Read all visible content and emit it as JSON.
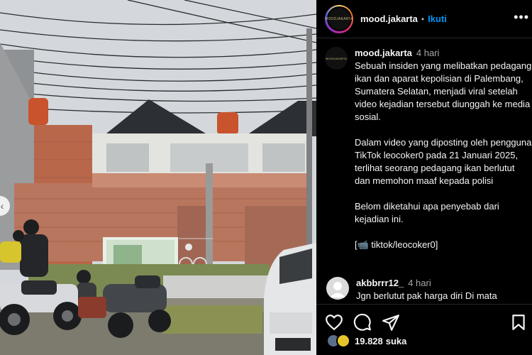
{
  "post": {
    "username": "mood.jakarta",
    "separator": "•",
    "follow_label": "Ikuti",
    "more_label": "•••",
    "avatar_text": "MOODJAKARTA"
  },
  "caption": {
    "username": "mood.jakarta",
    "time": "4 hari",
    "paragraphs": [
      "Sebuah insiden yang melibatkan pedagang ikan dan aparat kepolisian di Palembang, Sumatera Selatan, menjadi viral setelah video kejadian tersebut diunggah ke media sosial.",
      "Dalam video yang diposting oleh pengguna TikTok leocoker0 pada 21 Januari 2025, terlihat seorang pedagang ikan berlutut dan memohon maaf kepada polisi",
      "Belom diketahui apa penyebab dari kejadian ini.",
      "[📹 tiktok/leocoker0]"
    ]
  },
  "comment": {
    "username": "akbbrrr12_",
    "time": "4 hari",
    "text": "Jgn berlutut pak harga diri Di mata"
  },
  "actions": {
    "like_icon": "heart-icon",
    "comment_icon": "comment-icon",
    "share_icon": "share-icon",
    "save_icon": "bookmark-icon"
  },
  "likes": {
    "count": "19.828",
    "label": "suka"
  },
  "media": {
    "prev_arrow": "‹"
  }
}
